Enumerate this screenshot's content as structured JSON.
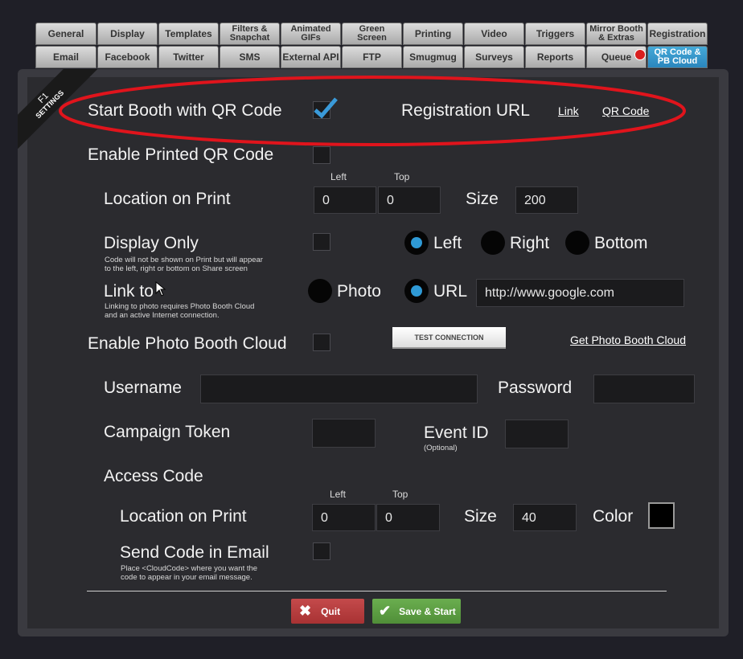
{
  "tabs_row1": [
    "General",
    "Display",
    "Templates",
    "Filters &\nSnapchat",
    "Animated\nGIFs",
    "Green\nScreen",
    "Printing",
    "Video",
    "Triggers",
    "Mirror Booth\n& Extras",
    "Registration"
  ],
  "tabs_row2": [
    "Email",
    "Facebook",
    "Twitter",
    "SMS",
    "External API",
    "FTP",
    "Smugmug",
    "Surveys",
    "Reports",
    "Queue",
    "QR Code &\nPB Cloud"
  ],
  "ribbon": {
    "key": "F1",
    "label": "SETTINGS"
  },
  "qr": {
    "start_label": "Start Booth with QR Code",
    "start_checked": true,
    "registration_url_label": "Registration URL",
    "link_label": "Link",
    "qrcode_label": "QR Code",
    "enable_printed_label": "Enable Printed QR Code",
    "location_label": "Location on Print",
    "left_small": "Left",
    "top_small": "Top",
    "left_value": "0",
    "top_value": "0",
    "size_label": "Size",
    "size_value": "200",
    "display_only_label": "Display Only",
    "display_only_note": "Code will not be shown on Print but will appear\nto the left, right or bottom on Share screen",
    "pos_left": "Left",
    "pos_right": "Right",
    "pos_bottom": "Bottom",
    "link_to_label": "Link to",
    "link_to_note": "Linking to photo requires Photo Booth Cloud\nand an active Internet connection.",
    "photo_label": "Photo",
    "url_label": "URL",
    "url_value": "http://www.google.com"
  },
  "cloud": {
    "enable_label": "Enable Photo Booth Cloud",
    "test_button": "TEST CONNECTION",
    "get_link": "Get Photo Booth Cloud",
    "username_label": "Username",
    "username_value": "",
    "password_label": "Password",
    "password_value": "",
    "campaign_label": "Campaign Token",
    "campaign_value": "",
    "event_label": "Event ID",
    "event_optional": "(Optional)",
    "event_value": "",
    "access_label": "Access Code",
    "location_label": "Location on Print",
    "left_small": "Left",
    "top_small": "Top",
    "left_value": "0",
    "top_value": "0",
    "size_label": "Size",
    "size_value": "40",
    "color_label": "Color",
    "color_value": "#000000",
    "send_label": "Send Code in Email",
    "send_note": "Place <CloudCode> where you want the\ncode to appear in your email message."
  },
  "footer": {
    "quit": "Quit",
    "save": "Save & Start"
  },
  "colors": {
    "accent": "#2f9ad6",
    "highlight_ellipse": "#e0141c",
    "quit": "#b8393b",
    "save": "#5c9f43"
  }
}
